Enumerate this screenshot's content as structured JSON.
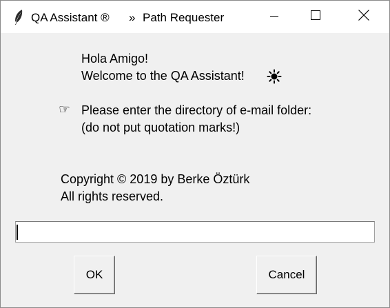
{
  "window": {
    "app_title": "QA Assistant ®",
    "separator": "»",
    "subtitle": "Path Requester",
    "app_icon": "feather-icon",
    "minimize_icon": "minimize-icon",
    "maximize_icon": "maximize-icon",
    "close_icon": "close-icon"
  },
  "greeting": {
    "line1": "Hola Amigo!",
    "line2": "Welcome to the QA Assistant!",
    "icon": "sun-icon"
  },
  "prompt": {
    "icon_glyph": "☞",
    "icon": "pointing-hand-icon",
    "line1": "Please enter the directory of e-mail folder:",
    "line2": "(do not put quotation marks!)"
  },
  "copyright": {
    "line1": "Copyright © 2019 by Berke Öztürk",
    "line2": "All rights reserved."
  },
  "path_input": {
    "value": "",
    "placeholder": ""
  },
  "buttons": {
    "ok_label": "OK",
    "cancel_label": "Cancel"
  },
  "colors": {
    "window_bg": "#f0f0f0",
    "titlebar_bg": "#ffffff",
    "input_bg": "#ffffff"
  }
}
